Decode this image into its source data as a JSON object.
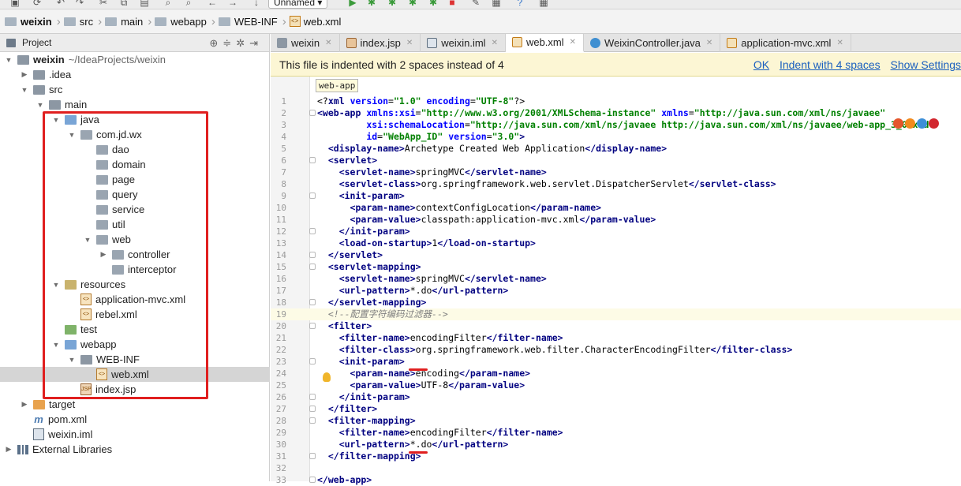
{
  "toolbar": {
    "run_config": "Unnamed"
  },
  "breadcrumbs": [
    "weixin",
    "src",
    "main",
    "webapp",
    "WEB-INF",
    "web.xml"
  ],
  "project_panel": {
    "title": "Project"
  },
  "tree": [
    {
      "label": "weixin",
      "extra": "~/IdeaProjects/weixin",
      "depth": 0,
      "arrow": "down",
      "icon": "module",
      "bold": true
    },
    {
      "label": ".idea",
      "depth": 1,
      "arrow": "right",
      "icon": "folder"
    },
    {
      "label": "src",
      "depth": 1,
      "arrow": "down",
      "icon": "folder"
    },
    {
      "label": "main",
      "depth": 2,
      "arrow": "down",
      "icon": "folder"
    },
    {
      "label": "java",
      "depth": 3,
      "arrow": "down",
      "icon": "folder-blue"
    },
    {
      "label": "com.jd.wx",
      "depth": 4,
      "arrow": "down",
      "icon": "package"
    },
    {
      "label": "dao",
      "depth": 5,
      "arrow": "",
      "icon": "package"
    },
    {
      "label": "domain",
      "depth": 5,
      "arrow": "",
      "icon": "package"
    },
    {
      "label": "page",
      "depth": 5,
      "arrow": "",
      "icon": "package"
    },
    {
      "label": "query",
      "depth": 5,
      "arrow": "",
      "icon": "package"
    },
    {
      "label": "service",
      "depth": 5,
      "arrow": "",
      "icon": "package"
    },
    {
      "label": "util",
      "depth": 5,
      "arrow": "",
      "icon": "package"
    },
    {
      "label": "web",
      "depth": 5,
      "arrow": "down",
      "icon": "package"
    },
    {
      "label": "controller",
      "depth": 6,
      "arrow": "right",
      "icon": "package"
    },
    {
      "label": "interceptor",
      "depth": 6,
      "arrow": "",
      "icon": "package"
    },
    {
      "label": "resources",
      "depth": 3,
      "arrow": "down",
      "icon": "folder-res"
    },
    {
      "label": "application-mvc.xml",
      "depth": 4,
      "arrow": "",
      "icon": "xml"
    },
    {
      "label": "rebel.xml",
      "depth": 4,
      "arrow": "",
      "icon": "xml"
    },
    {
      "label": "test",
      "depth": 3,
      "arrow": "",
      "icon": "folder-green"
    },
    {
      "label": "webapp",
      "depth": 3,
      "arrow": "down",
      "icon": "folder-blue"
    },
    {
      "label": "WEB-INF",
      "depth": 4,
      "arrow": "down",
      "icon": "folder"
    },
    {
      "label": "web.xml",
      "depth": 5,
      "arrow": "",
      "icon": "xml",
      "selected": true
    },
    {
      "label": "index.jsp",
      "depth": 4,
      "arrow": "",
      "icon": "jsp"
    },
    {
      "label": "target",
      "depth": 1,
      "arrow": "right",
      "icon": "folder-src"
    },
    {
      "label": "pom.xml",
      "depth": 1,
      "arrow": "",
      "icon": "pom"
    },
    {
      "label": "weixin.iml",
      "depth": 1,
      "arrow": "",
      "icon": "iml"
    },
    {
      "label": "External Libraries",
      "depth": 0,
      "arrow": "right",
      "icon": "lib"
    }
  ],
  "tabs": [
    {
      "label": "weixin",
      "icon": "m",
      "active": false
    },
    {
      "label": "index.jsp",
      "icon": "jsp",
      "active": false
    },
    {
      "label": "weixin.iml",
      "icon": "iml",
      "active": false
    },
    {
      "label": "web.xml",
      "icon": "xml",
      "active": true
    },
    {
      "label": "WeixinController.java",
      "icon": "c",
      "active": false
    },
    {
      "label": "application-mvc.xml",
      "icon": "xml",
      "active": false
    }
  ],
  "banner": {
    "message": "This file is indented with 2 spaces instead of 4",
    "ok": "OK",
    "indent": "Indent with 4 spaces",
    "settings": "Show Settings"
  },
  "editor": {
    "breadcrumb_tag": "web-app",
    "lines": [
      {
        "n": "1",
        "html": "<span class=\"pi\">&lt;?</span><span class=\"t\">xml</span> <span class=\"a\">version</span>=<span class=\"v\">\"1.0\"</span> <span class=\"a\">encoding</span>=<span class=\"v\">\"UTF-8\"</span><span class=\"pi\">?&gt;</span>"
      },
      {
        "n": "2",
        "html": "<span class=\"t\">&lt;web-app</span> <span class=\"a\">xmlns:xsi</span>=<span class=\"v\">\"http://www.w3.org/2001/XMLSchema-instance\"</span> <span class=\"a\">xmlns</span>=<span class=\"v\">\"http://java.sun.com/xml/ns/javaee\"</span>",
        "fold": true
      },
      {
        "n": "3",
        "html": "         <span class=\"a\">xsi:schemaLocation</span>=<span class=\"v\">\"http://java.sun.com/xml/ns/javaee http://java.sun.com/xml/ns/javaee/web-app_3_0.xsd\"</span>"
      },
      {
        "n": "4",
        "html": "         <span class=\"a\">id</span>=<span class=\"v\">\"WebApp_ID\"</span> <span class=\"a\">version</span>=<span class=\"v\">\"3.0\"</span><span class=\"t\">&gt;</span>"
      },
      {
        "n": "5",
        "html": "  <span class=\"t\">&lt;display-name&gt;</span>Archetype Created Web Application<span class=\"t\">&lt;/display-name&gt;</span>"
      },
      {
        "n": "6",
        "html": "  <span class=\"t\">&lt;servlet&gt;</span>",
        "fold": true
      },
      {
        "n": "7",
        "html": "    <span class=\"t\">&lt;servlet-name&gt;</span>springMVC<span class=\"t\">&lt;/servlet-name&gt;</span>"
      },
      {
        "n": "8",
        "html": "    <span class=\"t\">&lt;servlet-class&gt;</span>org.springframework.web.servlet.DispatcherServlet<span class=\"t\">&lt;/servlet-class&gt;</span>"
      },
      {
        "n": "9",
        "html": "    <span class=\"t\">&lt;init-param&gt;</span>",
        "fold": true
      },
      {
        "n": "10",
        "html": "      <span class=\"t\">&lt;param-name&gt;</span>contextConfigLocation<span class=\"t\">&lt;/param-name&gt;</span>"
      },
      {
        "n": "11",
        "html": "      <span class=\"t\">&lt;param-value&gt;</span>classpath:application-mvc.xml<span class=\"t\">&lt;/param-value&gt;</span>"
      },
      {
        "n": "12",
        "html": "    <span class=\"t\">&lt;/init-param&gt;</span>",
        "fold": true
      },
      {
        "n": "13",
        "html": "    <span class=\"t\">&lt;load-on-startup&gt;</span>1<span class=\"t\">&lt;/load-on-startup&gt;</span>"
      },
      {
        "n": "14",
        "html": "  <span class=\"t\">&lt;/servlet&gt;</span>",
        "fold": true
      },
      {
        "n": "15",
        "html": "  <span class=\"t\">&lt;servlet-mapping&gt;</span>",
        "fold": true
      },
      {
        "n": "16",
        "html": "    <span class=\"t\">&lt;servlet-name&gt;</span>springMVC<span class=\"t\">&lt;/servlet-name&gt;</span>"
      },
      {
        "n": "17",
        "html": "    <span class=\"t\">&lt;url-pattern&gt;</span>*.do<span class=\"t\">&lt;/url-pattern&gt;</span>"
      },
      {
        "n": "18",
        "html": "  <span class=\"t\">&lt;/servlet-mapping&gt;</span>",
        "fold": true
      },
      {
        "n": "19",
        "html": "  <span class=\"c\">&lt;!--配置字符编码过滤器--&gt;</span>",
        "hl": true
      },
      {
        "n": "20",
        "html": "  <span class=\"t\">&lt;filter&gt;</span>",
        "fold": true
      },
      {
        "n": "21",
        "html": "    <span class=\"t\">&lt;filter-name&gt;</span>encodingFilter<span class=\"t\">&lt;/filter-name&gt;</span>"
      },
      {
        "n": "22",
        "html": "    <span class=\"t\">&lt;filter-class&gt;</span>org.springframework.web.filter.CharacterEncodingFilter<span class=\"t\">&lt;/filter-class&gt;</span>"
      },
      {
        "n": "23",
        "html": "    <span class=\"t\">&lt;init-param&gt;</span>",
        "fold": true
      },
      {
        "n": "24",
        "html": "      <span class=\"t\">&lt;param-name&gt;</span>encoding<span class=\"t\">&lt;/param-name&gt;</span>"
      },
      {
        "n": "25",
        "html": "      <span class=\"t\">&lt;param-value&gt;</span>UTF-8<span class=\"t\">&lt;/param-value&gt;</span>"
      },
      {
        "n": "26",
        "html": "    <span class=\"t\">&lt;/init-param&gt;</span>",
        "fold": true
      },
      {
        "n": "27",
        "html": "  <span class=\"t\">&lt;/filter&gt;</span>",
        "fold": true
      },
      {
        "n": "28",
        "html": "  <span class=\"t\">&lt;filter-mapping&gt;</span>",
        "fold": true
      },
      {
        "n": "29",
        "html": "    <span class=\"t\">&lt;filter-name&gt;</span>encodingFilter<span class=\"t\">&lt;/filter-name&gt;</span>"
      },
      {
        "n": "30",
        "html": "    <span class=\"t\">&lt;url-pattern&gt;</span>*.do<span class=\"t\">&lt;/url-pattern&gt;</span>"
      },
      {
        "n": "31",
        "html": "  <span class=\"t\">&lt;/filter-mapping&gt;</span>",
        "fold": true
      },
      {
        "n": "32",
        "html": ""
      },
      {
        "n": "33",
        "html": "<span class=\"t\">&lt;/web-app&gt;</span>",
        "fold": true
      }
    ]
  }
}
